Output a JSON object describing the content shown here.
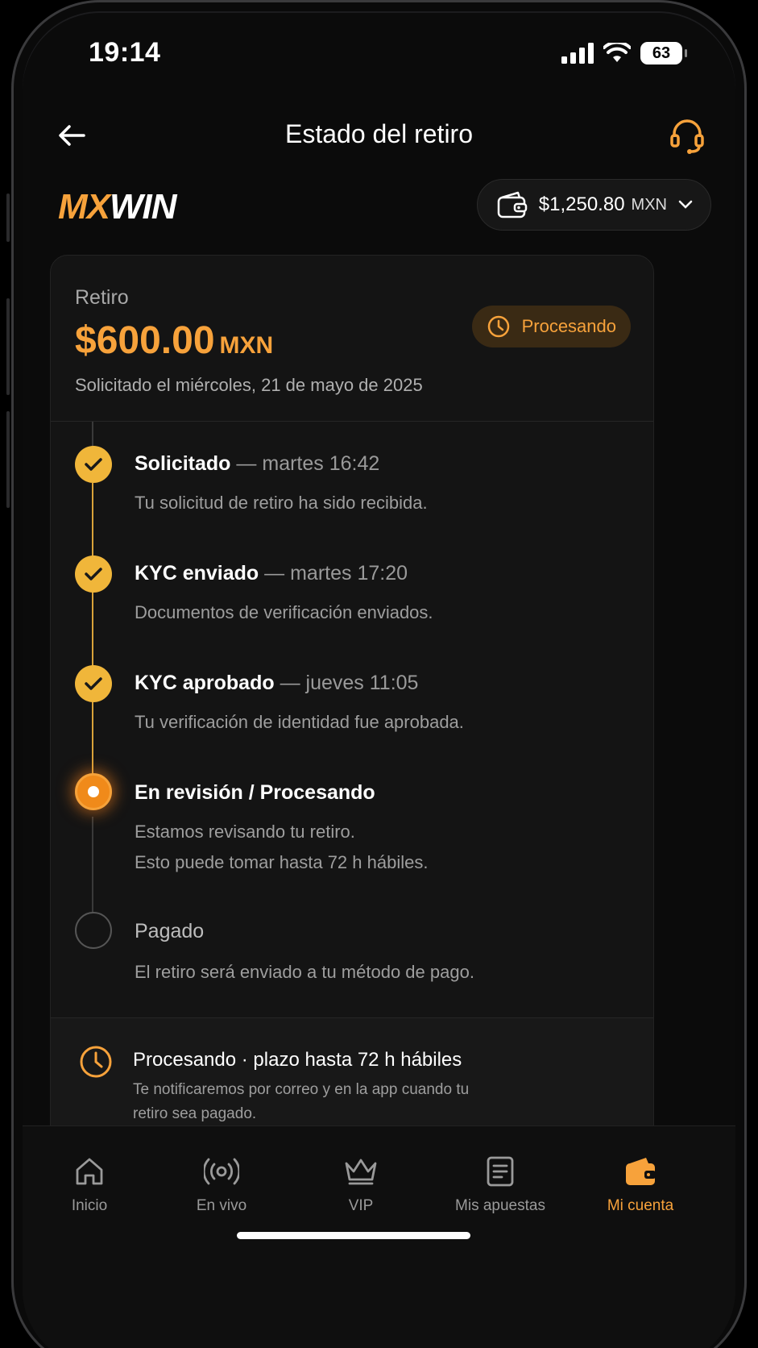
{
  "status_bar": {
    "time": "19:14",
    "battery": "63"
  },
  "header": {
    "title": "Estado del retiro"
  },
  "brand": {
    "mx": "MX",
    "win": "WIN"
  },
  "balance": {
    "amount": "$1,250.80",
    "currency": "MXN"
  },
  "withdrawal": {
    "label": "Retiro",
    "amount": "$600.00",
    "currency": "MXN",
    "requested_text": "Solicitado el miércoles, 21 de mayo de 2025",
    "status": "Procesando"
  },
  "timeline": {
    "steps": [
      {
        "title": "Solicitado",
        "time": "— martes 16:42",
        "desc1": "Tu solicitud de retiro ha sido recibida.",
        "desc2": "",
        "state": "done"
      },
      {
        "title": "KYC enviado",
        "time": "— martes 17:20",
        "desc1": "Documentos de verificación enviados.",
        "desc2": "",
        "state": "done"
      },
      {
        "title": "KYC aprobado",
        "time": "— jueves 11:05",
        "desc1": "Tu verificación de identidad fue aprobada.",
        "desc2": "",
        "state": "done"
      },
      {
        "title": "En revisión / Procesando",
        "time": "",
        "desc1": "Estamos revisando tu retiro.",
        "desc2": "Esto puede tomar hasta 72 h hábiles.",
        "state": "active"
      },
      {
        "title": "Pagado",
        "time": "",
        "desc1": "El retiro será enviado a tu método de pago.",
        "desc2": "",
        "state": "pending"
      }
    ]
  },
  "note": {
    "title": "Procesando · plazo hasta 72 h hábiles",
    "desc": "Te notificaremos por correo y en la app cuando tu retiro sea pagado."
  },
  "tabs": [
    {
      "label": "Inicio",
      "icon": "home-icon"
    },
    {
      "label": "En vivo",
      "icon": "live-icon"
    },
    {
      "label": "VIP",
      "icon": "crown-icon"
    },
    {
      "label": "Mis apuestas",
      "icon": "bet-slip-icon"
    },
    {
      "label": "Mi cuenta",
      "icon": "wallet-icon"
    }
  ],
  "colors": {
    "accent": "#f7a23b",
    "done": "#f0b63a",
    "background": "#0b0b0b"
  }
}
